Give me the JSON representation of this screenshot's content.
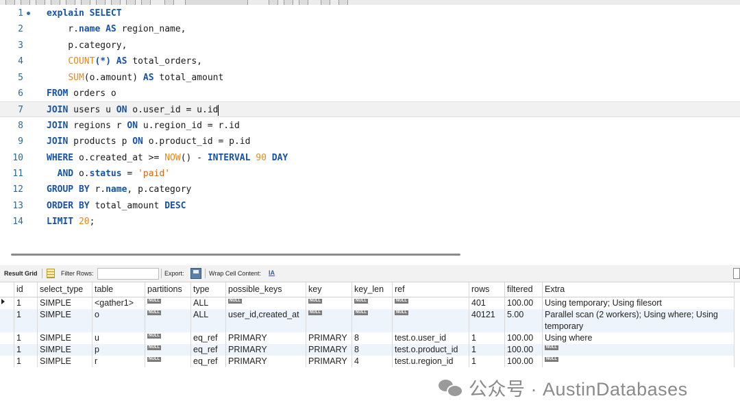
{
  "editor": {
    "lines": [
      {
        "n": "1",
        "parts": [
          {
            "t": "explain",
            "c": "kw"
          },
          {
            "t": " "
          },
          {
            "t": "SELECT",
            "c": "kw"
          }
        ]
      },
      {
        "n": "2",
        "parts": [
          {
            "t": "    r."
          },
          {
            "t": "name",
            "c": "kw"
          },
          {
            "t": " "
          },
          {
            "t": "AS",
            "c": "kw"
          },
          {
            "t": " region_name,"
          }
        ]
      },
      {
        "n": "3",
        "parts": [
          {
            "t": "    p.category,"
          }
        ]
      },
      {
        "n": "4",
        "parts": [
          {
            "t": "    "
          },
          {
            "t": "COUNT",
            "c": "fn"
          },
          {
            "t": "(*)",
            "c": "kw"
          },
          {
            "t": " "
          },
          {
            "t": "AS",
            "c": "kw"
          },
          {
            "t": " total_orders,"
          }
        ]
      },
      {
        "n": "5",
        "parts": [
          {
            "t": "    "
          },
          {
            "t": "SUM",
            "c": "fn"
          },
          {
            "t": "(o.amount) "
          },
          {
            "t": "AS",
            "c": "kw"
          },
          {
            "t": " total_amount"
          }
        ]
      },
      {
        "n": "6",
        "parts": [
          {
            "t": "FROM",
            "c": "kw"
          },
          {
            "t": " orders o"
          }
        ]
      },
      {
        "n": "7",
        "parts": [
          {
            "t": "JOIN",
            "c": "kw"
          },
          {
            "t": " users u "
          },
          {
            "t": "ON",
            "c": "kw"
          },
          {
            "t": " o.user_id = u.id"
          }
        ]
      },
      {
        "n": "8",
        "parts": [
          {
            "t": "JOIN",
            "c": "kw"
          },
          {
            "t": " regions r "
          },
          {
            "t": "ON",
            "c": "kw"
          },
          {
            "t": " u.region_id = r.id"
          }
        ]
      },
      {
        "n": "9",
        "parts": [
          {
            "t": "JOIN",
            "c": "kw"
          },
          {
            "t": " products p "
          },
          {
            "t": "ON",
            "c": "kw"
          },
          {
            "t": " o.product_id = p.id"
          }
        ]
      },
      {
        "n": "10",
        "parts": [
          {
            "t": "WHERE",
            "c": "kw"
          },
          {
            "t": " o.created_at >= "
          },
          {
            "t": "NOW",
            "c": "fn"
          },
          {
            "t": "() - "
          },
          {
            "t": "INTERVAL",
            "c": "kw"
          },
          {
            "t": " "
          },
          {
            "t": "90",
            "c": "num"
          },
          {
            "t": " "
          },
          {
            "t": "DAY",
            "c": "kw"
          }
        ]
      },
      {
        "n": "11",
        "parts": [
          {
            "t": "  "
          },
          {
            "t": "AND",
            "c": "kw"
          },
          {
            "t": " o."
          },
          {
            "t": "status",
            "c": "kw"
          },
          {
            "t": " = "
          },
          {
            "t": "'paid'",
            "c": "str"
          }
        ]
      },
      {
        "n": "12",
        "parts": [
          {
            "t": "GROUP BY",
            "c": "kw"
          },
          {
            "t": " r."
          },
          {
            "t": "name",
            "c": "kw"
          },
          {
            "t": ", p.category"
          }
        ]
      },
      {
        "n": "13",
        "parts": [
          {
            "t": "ORDER BY",
            "c": "kw"
          },
          {
            "t": " total_amount "
          },
          {
            "t": "DESC",
            "c": "kw"
          }
        ]
      },
      {
        "n": "14",
        "parts": [
          {
            "t": "LIMIT",
            "c": "kw"
          },
          {
            "t": " "
          },
          {
            "t": "20",
            "c": "num"
          },
          {
            "t": ";"
          }
        ]
      }
    ]
  },
  "result_toolbar": {
    "result_grid": "Result Grid",
    "filter_rows": "Filter Rows:",
    "export": "Export:",
    "wrap": "Wrap Cell Content:",
    "wrap_icon": "IA"
  },
  "grid": {
    "columns": [
      "id",
      "select_type",
      "table",
      "partitions",
      "type",
      "possible_keys",
      "key",
      "key_len",
      "ref",
      "rows",
      "filtered",
      "Extra"
    ],
    "null_label": "NULL",
    "rows": [
      [
        "1",
        "SIMPLE",
        "<gather1>",
        null,
        "ALL",
        null,
        null,
        null,
        null,
        "401",
        "100.00",
        "Using temporary; Using filesort"
      ],
      [
        "1",
        "SIMPLE",
        "o",
        null,
        "ALL",
        "user_id,created_at",
        null,
        null,
        null,
        "40121",
        "5.00",
        "Parallel scan (2 workers); Using where; Using temporary"
      ],
      [
        "1",
        "SIMPLE",
        "u",
        null,
        "eq_ref",
        "PRIMARY",
        "PRIMARY",
        "8",
        "test.o.user_id",
        "1",
        "100.00",
        "Using where"
      ],
      [
        "1",
        "SIMPLE",
        "p",
        null,
        "eq_ref",
        "PRIMARY",
        "PRIMARY",
        "8",
        "test.o.product_id",
        "1",
        "100.00",
        null
      ],
      [
        "1",
        "SIMPLE",
        "r",
        null,
        "eq_ref",
        "PRIMARY",
        "PRIMARY",
        "4",
        "test.u.region_id",
        "1",
        "100.00",
        null
      ]
    ]
  },
  "watermark": {
    "text": "公众号 · AustinDatabases",
    "icon": "wechat-icon"
  }
}
